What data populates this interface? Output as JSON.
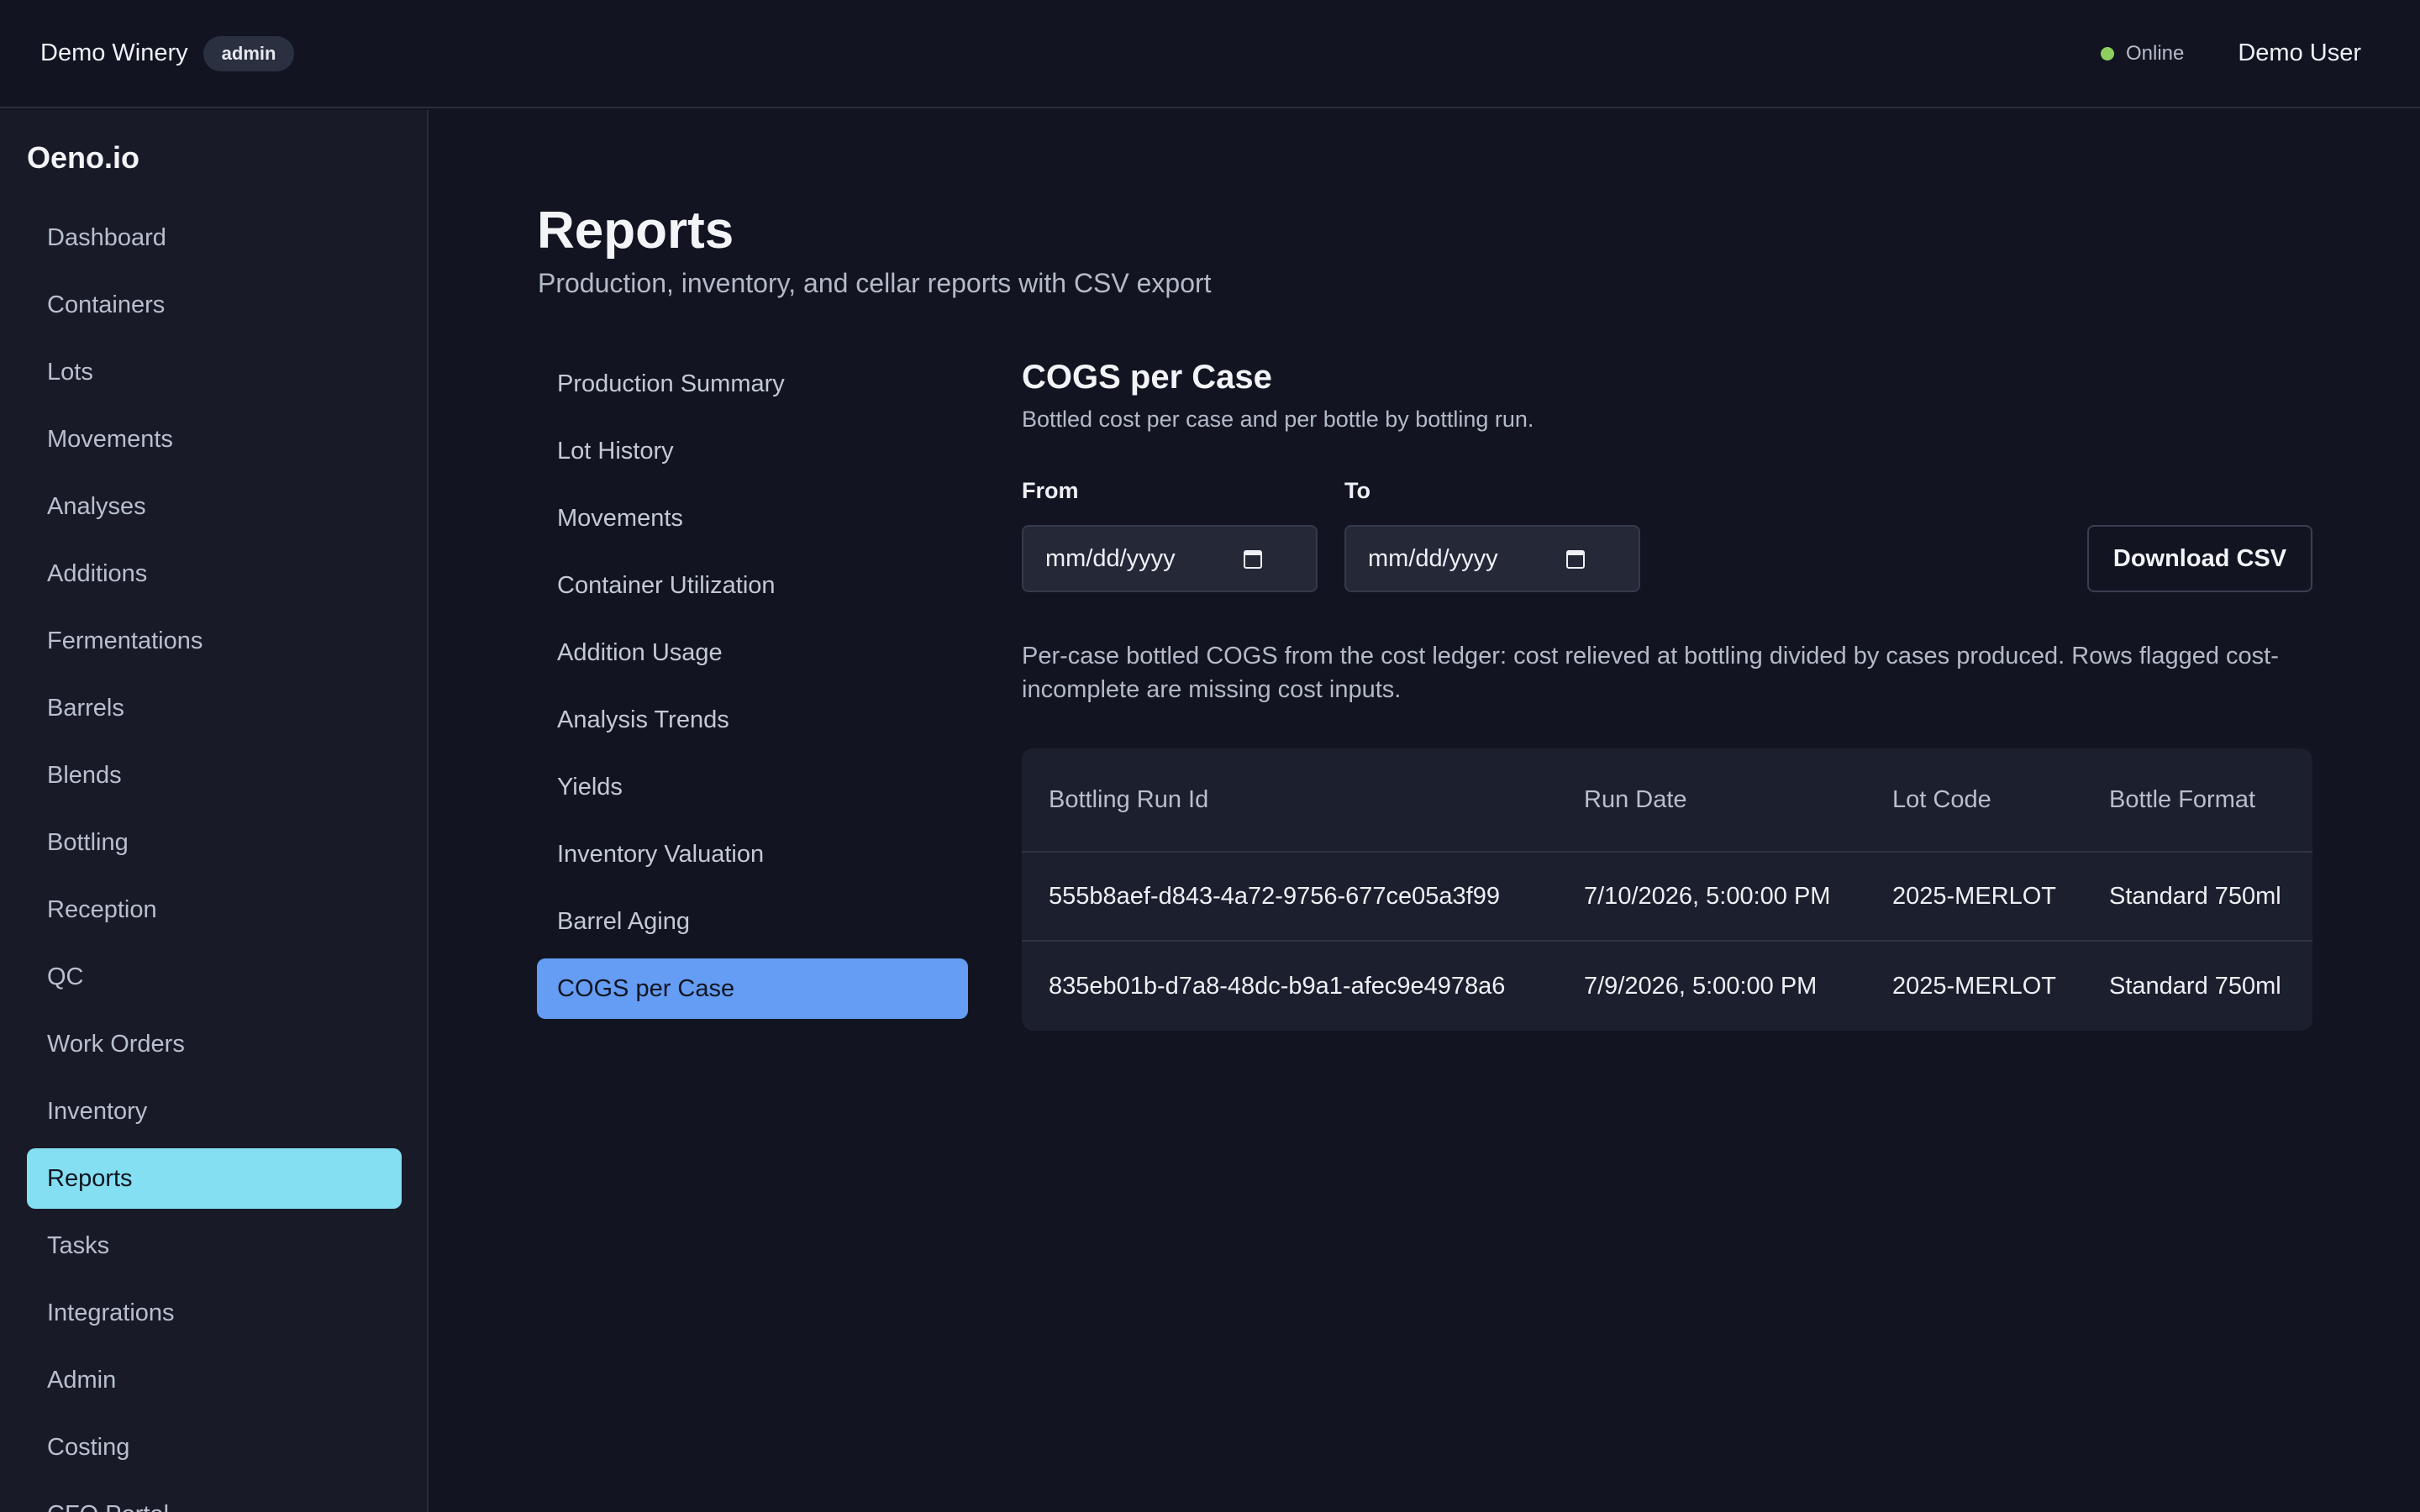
{
  "topbar": {
    "org_name": "Demo Winery",
    "role_badge": "admin",
    "status": "Online",
    "user_name": "Demo User"
  },
  "sidebar": {
    "brand": "Oeno.io",
    "items": [
      {
        "label": "Dashboard"
      },
      {
        "label": "Containers"
      },
      {
        "label": "Lots"
      },
      {
        "label": "Movements"
      },
      {
        "label": "Analyses"
      },
      {
        "label": "Additions"
      },
      {
        "label": "Fermentations"
      },
      {
        "label": "Barrels"
      },
      {
        "label": "Blends"
      },
      {
        "label": "Bottling"
      },
      {
        "label": "Reception"
      },
      {
        "label": "QC"
      },
      {
        "label": "Work Orders"
      },
      {
        "label": "Inventory"
      },
      {
        "label": "Reports"
      },
      {
        "label": "Tasks"
      },
      {
        "label": "Integrations"
      },
      {
        "label": "Admin"
      },
      {
        "label": "Costing"
      },
      {
        "label": "CFO Portal"
      }
    ],
    "active_index": 14
  },
  "page": {
    "title": "Reports",
    "subtitle": "Production, inventory, and cellar reports with CSV export"
  },
  "reports": {
    "items": [
      {
        "label": "Production Summary"
      },
      {
        "label": "Lot History"
      },
      {
        "label": "Movements"
      },
      {
        "label": "Container Utilization"
      },
      {
        "label": "Addition Usage"
      },
      {
        "label": "Analysis Trends"
      },
      {
        "label": "Yields"
      },
      {
        "label": "Inventory Valuation"
      },
      {
        "label": "Barrel Aging"
      },
      {
        "label": "COGS per Case"
      }
    ],
    "active_index": 9
  },
  "report": {
    "title": "COGS per Case",
    "description": "Bottled cost per case and per bottle by bottling run.",
    "from_label": "From",
    "to_label": "To",
    "from_placeholder": "mm/dd/yyyy",
    "to_placeholder": "mm/dd/yyyy",
    "download_label": "Download CSV",
    "note": "Per-case bottled COGS from the cost ledger: cost relieved at bottling divided by cases produced. Rows flagged cost-incomplete are missing cost inputs.",
    "table": {
      "columns": [
        "Bottling Run Id",
        "Run Date",
        "Lot Code",
        "Bottle Format"
      ],
      "rows": [
        [
          "555b8aef-d843-4a72-9756-677ce05a3f99",
          "7/10/2026, 5:00:00 PM",
          "2025-MERLOT",
          "Standard 750ml"
        ],
        [
          "835eb01b-d7a8-48dc-b9a1-afec9e4978a6",
          "7/9/2026, 5:00:00 PM",
          "2025-MERLOT",
          "Standard 750ml"
        ]
      ]
    }
  },
  "colors": {
    "background": "#121521",
    "sidebar_active": "#85dff3",
    "report_active": "#659cf4",
    "status_online": "#8fcf5f"
  }
}
